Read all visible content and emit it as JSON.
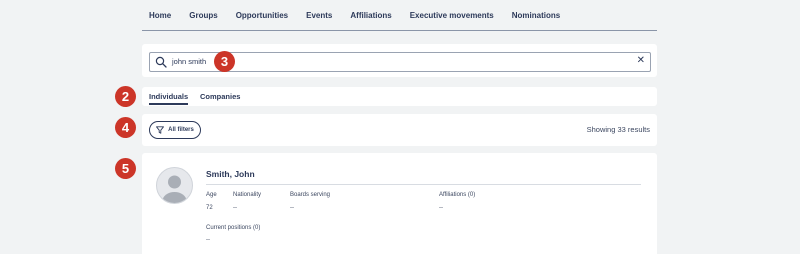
{
  "nav": {
    "items": [
      "Home",
      "Groups",
      "Opportunities",
      "Events",
      "Affiliations",
      "Executive movements",
      "Nominations"
    ]
  },
  "search": {
    "value": "john smith",
    "clear_symbol": "✕",
    "icon": "search-icon"
  },
  "tabs": [
    {
      "label": "Individuals",
      "active": true
    },
    {
      "label": "Companies",
      "active": false
    }
  ],
  "filters": {
    "button_label": "All filters",
    "icon": "filter-icon",
    "results_text": "Showing 33 results"
  },
  "result": {
    "name": "Smith, John",
    "fields": {
      "age": {
        "label": "Age",
        "value": "72"
      },
      "nationality": {
        "label": "Nationality",
        "value": "--"
      },
      "boards": {
        "label": "Boards serving",
        "value": "--"
      },
      "affiliations": {
        "label": "Affiliations (0)",
        "value": "--"
      },
      "positions": {
        "label": "Current positions (0)",
        "value": "--"
      }
    }
  },
  "markers": [
    "2",
    "3",
    "4",
    "5"
  ],
  "colors": {
    "marker": "#cc3528",
    "primary_text": "#2d3a5a",
    "background": "#f1f3f4"
  }
}
